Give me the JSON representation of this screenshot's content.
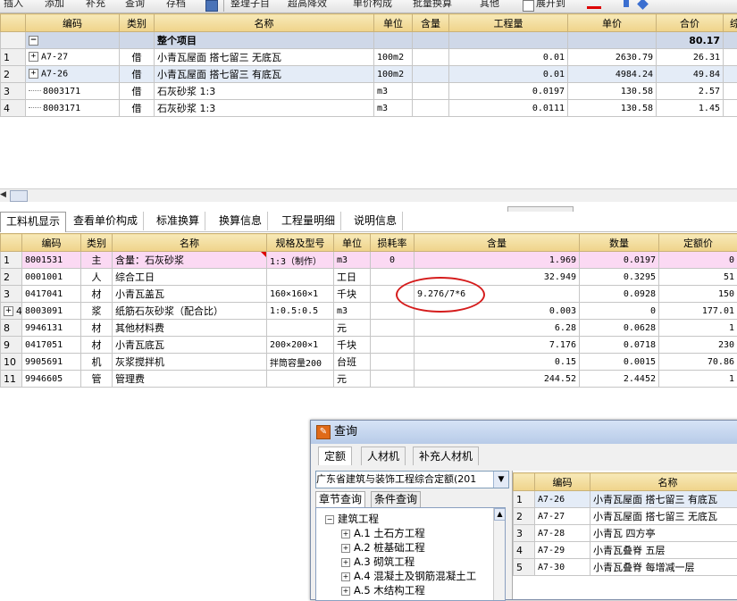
{
  "toolbar": {
    "items": [
      "插入",
      "添加",
      "补充",
      "查询",
      "存档",
      "整理子目",
      "超高降效",
      "单价构成",
      "批量换算",
      "其他",
      "展开到"
    ]
  },
  "top_grid": {
    "headers": [
      "",
      "编码",
      "类别",
      "名称",
      "单位",
      "含量",
      "工程量",
      "单价",
      "合价",
      "综"
    ],
    "group_row": {
      "expander": "−",
      "name": "整个项目",
      "total": "80.17"
    },
    "rows": [
      {
        "num": "1",
        "code": "A7-27",
        "cat": "借",
        "name": "小青瓦屋面 搭七留三 无底瓦",
        "unit": "100m2",
        "content": "",
        "qty": "0.01",
        "price": "2630.79",
        "total": "26.31"
      },
      {
        "num": "2",
        "code": "A7-26",
        "cat": "借",
        "name": "小青瓦屋面 搭七留三 有底瓦",
        "unit": "100m2",
        "content": "",
        "qty": "0.01",
        "price": "4984.24",
        "total": "49.84"
      },
      {
        "num": "3",
        "code": "8003171",
        "cat": "借",
        "name": "石灰砂浆 1:3",
        "unit": "m3",
        "content": "",
        "qty": "0.0197",
        "price": "130.58",
        "total": "2.57"
      },
      {
        "num": "4",
        "code": "8003171",
        "cat": "借",
        "name": "石灰砂浆 1:3",
        "unit": "m3",
        "content": "",
        "qty": "0.0111",
        "price": "130.58",
        "total": "1.45"
      }
    ]
  },
  "tabs": [
    "工料机显示",
    "查看单价构成",
    "标准换算",
    "换算信息",
    "工程量明细",
    "说明信息"
  ],
  "bottom_grid": {
    "headers": [
      "",
      "编码",
      "类别",
      "名称",
      "规格及型号",
      "单位",
      "损耗率",
      "含量",
      "数量",
      "定额价"
    ],
    "rows": [
      {
        "num": "1",
        "code": "8001531",
        "cat": "主",
        "name": "含量：石灰砂浆",
        "spec": "1:3（制作）",
        "unit": "m3",
        "loss": "0",
        "content": "1.969",
        "qty": "0.0197",
        "price": "0"
      },
      {
        "num": "2",
        "code": "0001001",
        "cat": "人",
        "name": "综合工日",
        "spec": "",
        "unit": "工日",
        "loss": "",
        "content": "32.949",
        "qty": "0.3295",
        "price": "51"
      },
      {
        "num": "3",
        "code": "0417041",
        "cat": "材",
        "name": "小青瓦盖瓦",
        "spec": "160×160×1",
        "unit": "千块",
        "loss": "",
        "content": "9.276/7*6",
        "qty": "0.0928",
        "price": "150"
      },
      {
        "num": "4",
        "code": "8003091",
        "cat": "浆",
        "name": "纸筋石灰砂浆（配合比）",
        "spec": "1:0.5:0.5",
        "unit": "m3",
        "loss": "",
        "content": "0.003",
        "qty": "0",
        "price": "177.01"
      },
      {
        "num": "8",
        "code": "9946131",
        "cat": "材",
        "name": "其他材料费",
        "spec": "",
        "unit": "元",
        "loss": "",
        "content": "6.28",
        "qty": "0.0628",
        "price": "1"
      },
      {
        "num": "9",
        "code": "0417051",
        "cat": "材",
        "name": "小青瓦底瓦",
        "spec": "200×200×1",
        "unit": "千块",
        "loss": "",
        "content": "7.176",
        "qty": "0.0718",
        "price": "230"
      },
      {
        "num": "10",
        "code": "9905691",
        "cat": "机",
        "name": "灰浆搅拌机",
        "spec": "拌筒容量200",
        "unit": "台班",
        "loss": "",
        "content": "0.15",
        "qty": "0.0015",
        "price": "70.86"
      },
      {
        "num": "11",
        "code": "9946605",
        "cat": "管",
        "name": "管理费",
        "spec": "",
        "unit": "元",
        "loss": "",
        "content": "244.52",
        "qty": "2.4452",
        "price": "1"
      }
    ]
  },
  "dialog": {
    "title": "查询",
    "tabs": [
      "定额",
      "人材机",
      "补充人材机"
    ],
    "quota_select": "广东省建筑与装饰工程综合定额(201",
    "subtabs": [
      "章节查询",
      "条件查询"
    ],
    "tree": [
      {
        "label": "建筑工程",
        "level": 0,
        "expander": "−"
      },
      {
        "label": "A.1 土石方工程",
        "level": 1,
        "expander": "+"
      },
      {
        "label": "A.2 桩基础工程",
        "level": 1,
        "expander": "+"
      },
      {
        "label": "A.3 砌筑工程",
        "level": 1,
        "expander": "+"
      },
      {
        "label": "A.4 混凝土及钢筋混凝土工",
        "level": 1,
        "expander": "+"
      },
      {
        "label": "A.5 木结构工程",
        "level": 1,
        "expander": "+"
      }
    ],
    "result_headers": [
      "",
      "编码",
      "名称"
    ],
    "results": [
      {
        "num": "1",
        "code": "A7-26",
        "name": "小青瓦屋面 搭七留三 有底瓦"
      },
      {
        "num": "2",
        "code": "A7-27",
        "name": "小青瓦屋面 搭七留三 无底瓦"
      },
      {
        "num": "3",
        "code": "A7-28",
        "name": "小青瓦 四方亭"
      },
      {
        "num": "4",
        "code": "A7-29",
        "name": "小青瓦叠脊 五层"
      },
      {
        "num": "5",
        "code": "A7-30",
        "name": "小青瓦叠脊 每增减一层"
      }
    ]
  },
  "colors": {
    "header_bg": "#efd38a",
    "pink_row": "#fbd9f3",
    "group_row": "#cfd8e8",
    "annotation": "#d51c1c"
  }
}
